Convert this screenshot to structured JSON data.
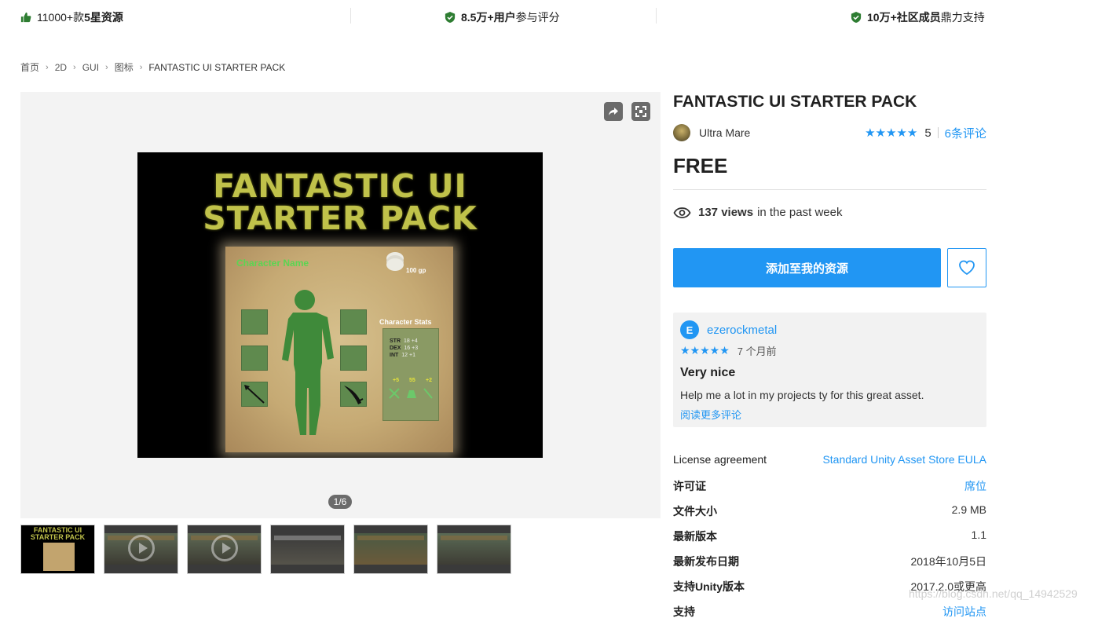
{
  "colors": {
    "accent": "#2196f3",
    "trust_green": "#2e7d32",
    "hero_text": "#c0c24a"
  },
  "trust_bar": [
    {
      "icon": "thumbs-up-icon",
      "pre": "11000+款",
      "bold": "5星资源",
      "post": ""
    },
    {
      "icon": "shield-check-icon",
      "pre": "",
      "bold": "8.5万+用户",
      "post": "参与评分"
    },
    {
      "icon": "shield-check-icon",
      "pre": "",
      "bold": "10万+社区成员",
      "post": "鼎力支持"
    }
  ],
  "breadcrumb": [
    "首页",
    "2D",
    "GUI",
    "图标",
    "FANTASTIC UI STARTER PACK"
  ],
  "gallery": {
    "share_icon": "share-icon",
    "fullscreen_icon": "fullscreen-icon",
    "hero": {
      "line1": "FANTASTIC UI",
      "line2": "STARTER PACK",
      "character_name": "Character Name",
      "gold": "100 gp",
      "stats_title": "Character Stats",
      "stats": [
        {
          "label": "STR",
          "value": "18 +4"
        },
        {
          "label": "DEX",
          "value": "16 +3"
        },
        {
          "label": "INT",
          "value": "12 +1"
        }
      ],
      "stat_icons": [
        "+5",
        "55",
        "+2"
      ]
    },
    "counter": "1/6",
    "thumbnails": [
      {
        "kind": "image",
        "title": "FANTASTIC UI STARTER PACK"
      },
      {
        "kind": "video"
      },
      {
        "kind": "video"
      },
      {
        "kind": "image"
      },
      {
        "kind": "image"
      },
      {
        "kind": "image"
      }
    ]
  },
  "product": {
    "title": "FANTASTIC UI STARTER PACK",
    "publisher": "Ultra Mare",
    "stars": "★★★★★",
    "rating": "5",
    "reviews_link": "6条评论",
    "price": "FREE",
    "views_bold": "137 views",
    "views_rest": "in the past week",
    "add_button": "添加至我的资源",
    "favorite_icon": "heart-icon"
  },
  "review": {
    "avatar_letter": "E",
    "author": "ezerockmetal",
    "stars": "★★★★★",
    "time": "7 个月前",
    "title": "Very nice",
    "body": "Help me a lot in my projects ty for this great asset.",
    "more_link": "阅读更多评论"
  },
  "info": [
    {
      "key": "License agreement",
      "value": "Standard Unity Asset Store EULA",
      "link": true,
      "cn": false
    },
    {
      "key": "许可证",
      "value": "席位",
      "link": true,
      "cn": true
    },
    {
      "key": "文件大小",
      "value": "2.9 MB",
      "link": false,
      "cn": true
    },
    {
      "key": "最新版本",
      "value": "1.1",
      "link": false,
      "cn": true
    },
    {
      "key": "最新发布日期",
      "value": "2018年10月5日",
      "link": false,
      "cn": true
    },
    {
      "key": "支持Unity版本",
      "value": "2017.2.0或更高",
      "link": false,
      "cn": true
    },
    {
      "key": "支持",
      "value": "访问站点",
      "link": true,
      "cn": true
    }
  ],
  "watermark": "https://blog.csdn.net/qq_14942529"
}
